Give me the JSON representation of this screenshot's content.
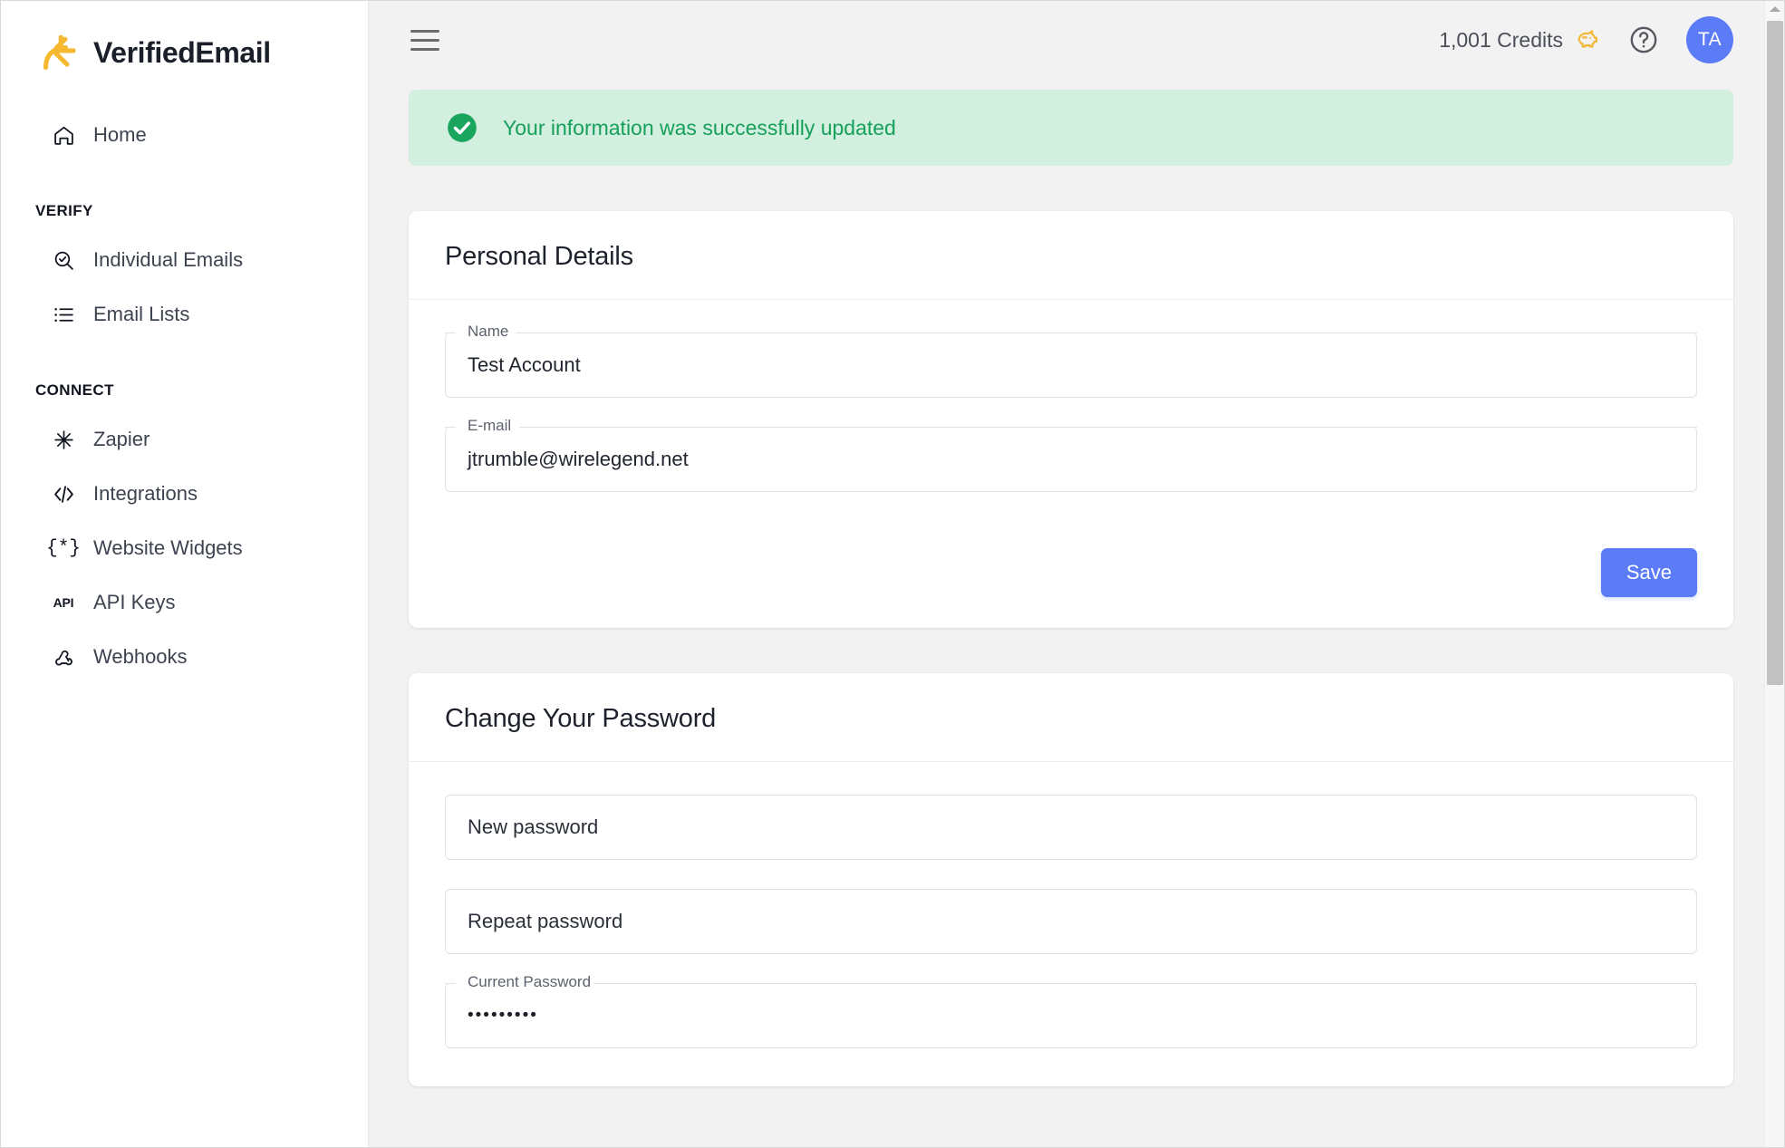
{
  "brand": {
    "name": "VerifiedEmail",
    "logo_icon": "starburst-icon",
    "logo_color": "#f5b82e"
  },
  "sidebar": {
    "home": {
      "label": "Home",
      "icon": "home-icon"
    },
    "sections": [
      {
        "label": "VERIFY",
        "items": [
          {
            "label": "Individual Emails",
            "icon": "search-check-icon"
          },
          {
            "label": "Email Lists",
            "icon": "list-icon"
          }
        ]
      },
      {
        "label": "CONNECT",
        "items": [
          {
            "label": "Zapier",
            "icon": "zapier-starburst-icon"
          },
          {
            "label": "Integrations",
            "icon": "code-icon"
          },
          {
            "label": "Website Widgets",
            "icon": "curly-brace-asterisk-icon"
          },
          {
            "label": "API Keys",
            "icon": "api-text-icon"
          },
          {
            "label": "Webhooks",
            "icon": "webhook-icon"
          }
        ]
      }
    ]
  },
  "topbar": {
    "menu_icon": "hamburger-menu-icon",
    "credits_text": "1,001 Credits",
    "credits_icon": "piggy-bank-icon",
    "credits_icon_color": "#f2b93c",
    "help_icon": "question-mark-circle-icon",
    "avatar_initials": "TA",
    "avatar_color": "#5b7cf6"
  },
  "alert": {
    "icon": "check-circle-icon",
    "message": "Your information was successfully updated",
    "text_color": "#16a05a",
    "background_color": "#d3efdf"
  },
  "personal_details": {
    "title": "Personal Details",
    "fields": [
      {
        "label": "Name",
        "value": "Test Account"
      },
      {
        "label": "E-mail",
        "value": "jtrumble@wirelegend.net"
      }
    ],
    "save_label": "Save",
    "save_color": "#5b7cf6"
  },
  "change_password": {
    "title": "Change Your Password",
    "new_password_placeholder": "New password",
    "repeat_password_placeholder": "Repeat password",
    "current_password_label": "Current Password",
    "current_password_value": "•••••••••"
  }
}
